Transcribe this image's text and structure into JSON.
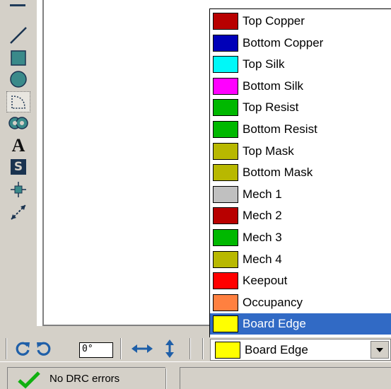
{
  "tools": [
    {
      "name": "line-tool-icon"
    },
    {
      "name": "rectangle-tool-icon"
    },
    {
      "name": "circle-tool-icon"
    },
    {
      "name": "arc-tool-icon"
    },
    {
      "name": "pad-tool-icon"
    },
    {
      "name": "text-tool-icon",
      "glyph": "A"
    },
    {
      "name": "symbol-tool-icon",
      "glyph": "S"
    },
    {
      "name": "origin-tool-icon"
    },
    {
      "name": "measure-tool-icon"
    }
  ],
  "layers": [
    {
      "label": "Top Copper",
      "color": "#b80000"
    },
    {
      "label": "Bottom Copper",
      "color": "#0000b8"
    },
    {
      "label": "Top Silk",
      "color": "#00f8f8"
    },
    {
      "label": "Bottom Silk",
      "color": "#ff00ff"
    },
    {
      "label": "Top Resist",
      "color": "#00b800"
    },
    {
      "label": "Bottom Resist",
      "color": "#00b800"
    },
    {
      "label": "Top Mask",
      "color": "#b8b800"
    },
    {
      "label": "Bottom Mask",
      "color": "#b8b800"
    },
    {
      "label": "Mech 1",
      "color": "#c0c0c0"
    },
    {
      "label": "Mech 2",
      "color": "#b80000"
    },
    {
      "label": "Mech 3",
      "color": "#00b800"
    },
    {
      "label": "Mech 4",
      "color": "#b8b800"
    },
    {
      "label": "Keepout",
      "color": "#ff0000"
    },
    {
      "label": "Occupancy",
      "color": "#ff8040"
    },
    {
      "label": "Board Edge",
      "color": "#ffff00",
      "selected": true
    }
  ],
  "bottom_toolbar": {
    "angle_value": "0°",
    "layer_combo_value": "Board Edge",
    "layer_combo_color": "#ffff00"
  },
  "status": {
    "drc_text": "No DRC errors"
  },
  "colors": {
    "selection": "#316ac5",
    "face": "#d4d0c8"
  }
}
